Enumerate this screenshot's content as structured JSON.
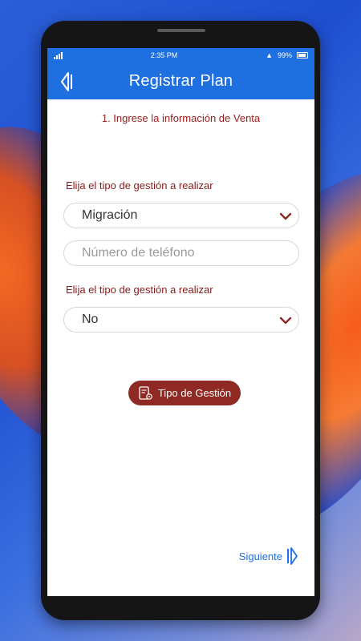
{
  "status_bar": {
    "time": "2:35 PM",
    "battery": "99%"
  },
  "header": {
    "title": "Registrar Plan"
  },
  "step_title": "1. Ingrese la información de Venta",
  "form": {
    "label_1": "Elija el tipo de gestión a realizar",
    "select_1_value": "Migración",
    "phone_placeholder": "Número de teléfono",
    "label_2": "Elija el tipo de gestión a realizar",
    "select_2_value": "No"
  },
  "actions": {
    "tipo_gestion_label": "Tipo de Gestión",
    "next_label": "Siguiente"
  },
  "colors": {
    "primary": "#1e6fe0",
    "accent_red": "#8e2a23",
    "label_red": "#8b1a1a"
  },
  "icons": [
    "back-arrow-icon",
    "chevron-down-icon",
    "document-gear-icon",
    "next-arrow-icon",
    "signal-icon",
    "battery-icon"
  ]
}
